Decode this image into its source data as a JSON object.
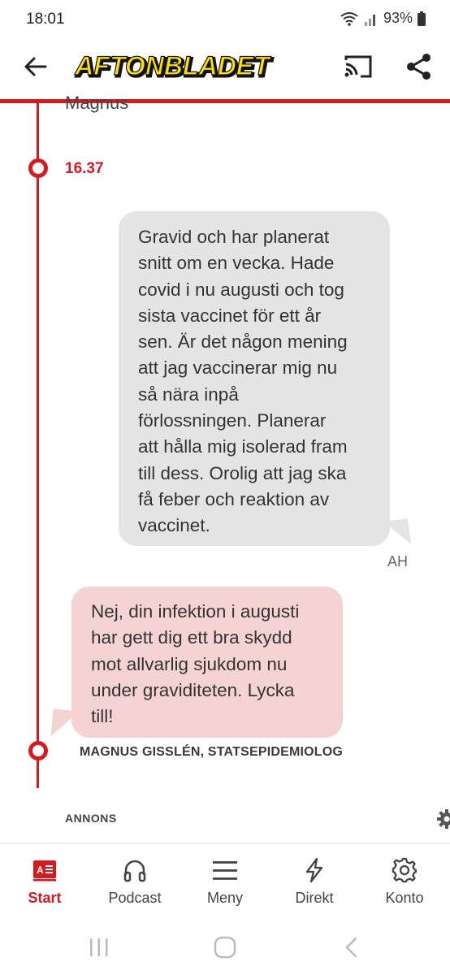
{
  "status_bar": {
    "time": "18:01",
    "battery_percent": "93%"
  },
  "app_bar": {
    "title": "Aftonbladet",
    "logo_text": "AFTONBLADET"
  },
  "feed": {
    "previous_author_partial": "Magnus",
    "timestamp": "16.37",
    "question": {
      "lines": [
        "Gravid och har planerat",
        "snitt om en vecka. Hade",
        "covid i nu augusti och tog",
        "sista vaccinet för ett år",
        "sen. Är det någon mening",
        "att jag vaccinerar mig nu",
        "så nära inpå",
        "förlossningen. Planerar",
        "att hålla mig isolerad fram",
        "till dess. Orolig att jag ska",
        "få feber och reaktion av",
        "vaccinet."
      ],
      "initials": "AH"
    },
    "answer": {
      "lines": [
        "Nej, din infektion i augusti",
        "har gett dig ett bra skydd",
        "mot allvarlig sjukdom nu",
        "under graviditeten. Lycka",
        "till!"
      ],
      "author": "MAGNUS GISSLÉN, STATSEPIDEMIOLOG"
    },
    "ad_label": "ANNONS"
  },
  "bottom_nav": {
    "items": [
      {
        "label": "Start",
        "icon": "newspaper-icon",
        "active": true
      },
      {
        "label": "Podcast",
        "icon": "headphones-icon",
        "active": false
      },
      {
        "label": "Meny",
        "icon": "menu-icon",
        "active": false
      },
      {
        "label": "Direkt",
        "icon": "lightning-icon",
        "active": false
      },
      {
        "label": "Konto",
        "icon": "gear-icon",
        "active": false
      }
    ]
  },
  "colors": {
    "accent": "#d71920",
    "question_bubble": "#e4e4e4",
    "answer_bubble": "#f6d3d3",
    "logo_yellow": "#ffe100"
  }
}
